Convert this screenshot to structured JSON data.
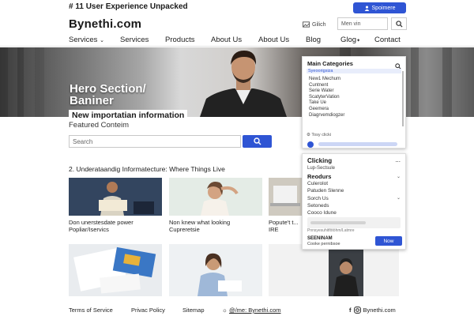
{
  "topbar": {
    "title": "# 11 User Experience Unpacked",
    "button_label": "Spoimere"
  },
  "header": {
    "brand": "Bynethi.com",
    "tool_label": "Gilich",
    "field_placeholder": "Men vin",
    "nav": [
      "Services",
      "Services",
      "Products",
      "About Us",
      "About Us",
      "Blog",
      "Glog",
      "Contact"
    ]
  },
  "hero": {
    "title_line1": "Hero Section/",
    "title_line2": "Baniner",
    "banner": "New importatian information",
    "featured": "Featured Conteim"
  },
  "search": {
    "placeholder": "Search"
  },
  "section": {
    "title": "2. Underataandig Informatecture: Where Things Live",
    "cards": [
      {
        "caption": "Don unerstesdate power Popliar/Iservics"
      },
      {
        "caption": "Non knew what looking Cupreretsie"
      },
      {
        "caption": "Popute't t... IRE"
      }
    ]
  },
  "categories_panel": {
    "title": "Main Categories",
    "subtitle": "Syeoorigsiza",
    "items": [
      "New1 Mechum",
      "Cuntnent",
      "Serie Water",
      "ScatyterVation",
      "Take Ue",
      "Geemera",
      "Diagrvemdiogzer"
    ],
    "footer": "Tosy clicki"
  },
  "clicking_panel": {
    "title": "Clicking",
    "more": "...",
    "subtitle": "Lup-Sectsule",
    "heading": "Reodurs",
    "rows": [
      "Culerolot",
      "Patuden Slenne",
      "Sorch Us",
      "Setoneds",
      "Cooco Idune"
    ],
    "small_text": "Pnnsyesuhitfötöhm/Latmre",
    "cookie_title": "SEENINAM",
    "cookie_text": "Cooke pernibsoe",
    "button_label": "Now"
  },
  "footer": {
    "links": [
      "Terms of Service",
      "Privac Policy",
      "Sitemap"
    ],
    "handle_left": "@/me: Bynethi.com",
    "handle_right": "Bynethi.com"
  },
  "colors": {
    "accent": "#2f55d4"
  }
}
